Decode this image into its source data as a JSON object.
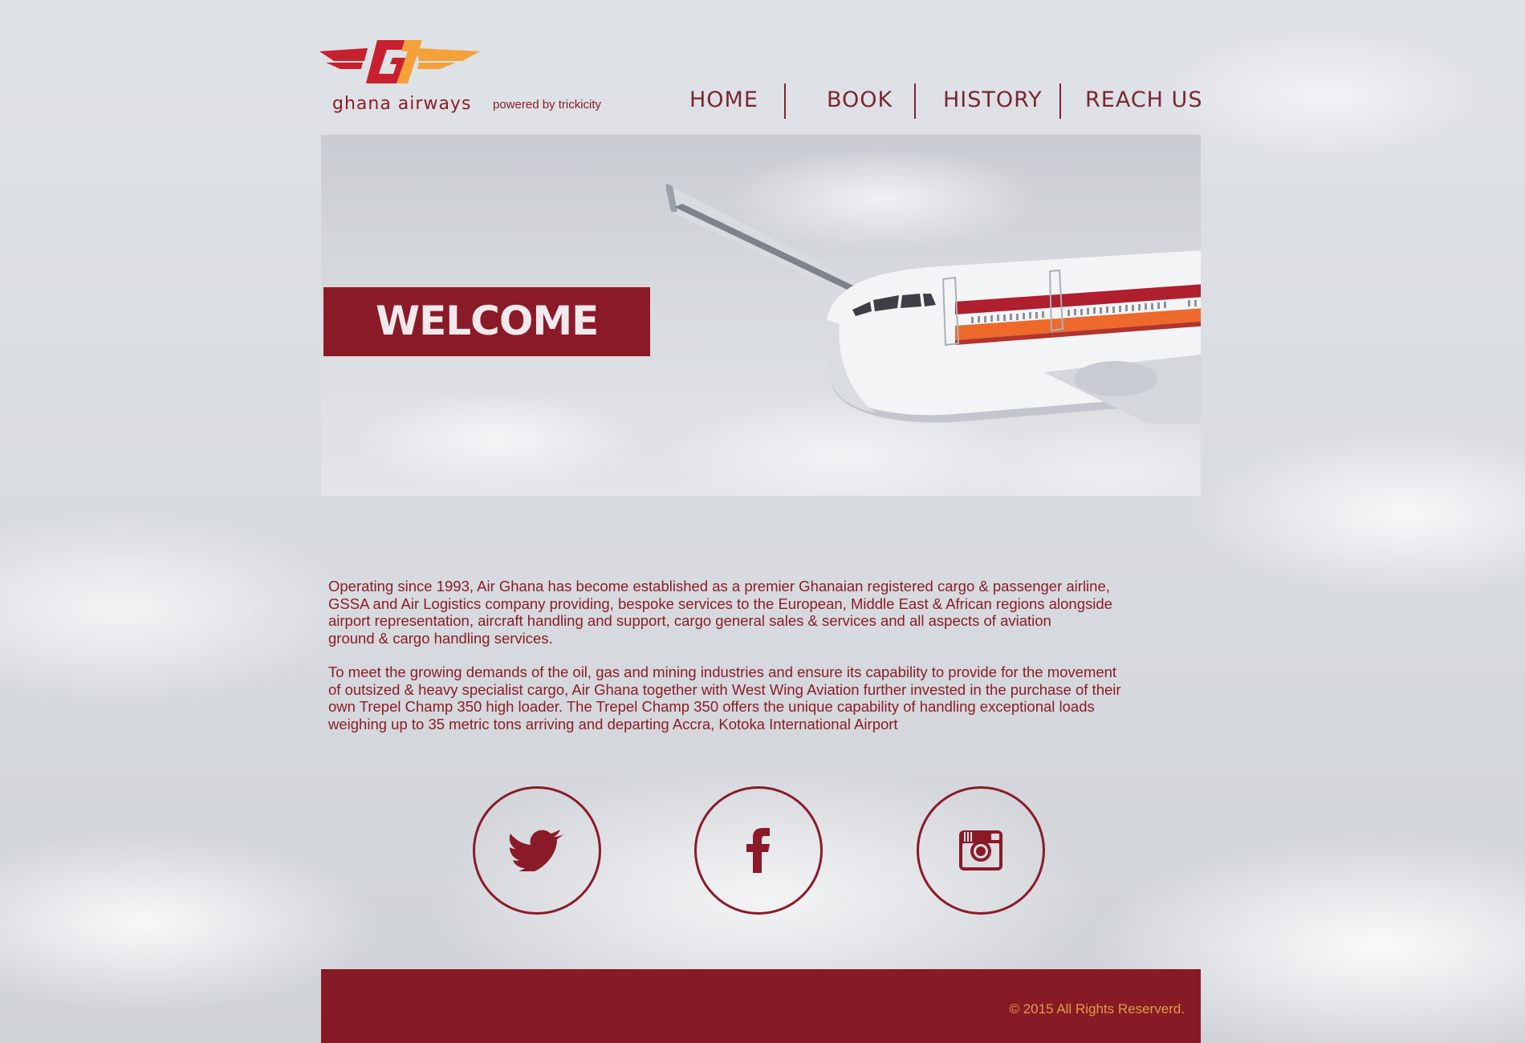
{
  "header": {
    "logo_text": "ghana airways",
    "powered_by": "powered by trickicity"
  },
  "nav": {
    "items": [
      {
        "label": "HOME"
      },
      {
        "label": "BOOK"
      },
      {
        "label": "HISTORY"
      },
      {
        "label": "REACH US"
      }
    ]
  },
  "hero": {
    "welcome": "WELCOME"
  },
  "content": {
    "paragraph_1": "Operating since 1993, Air Ghana has become established as a premier Ghanaian registered cargo & passenger airline,\nGSSA and Air Logistics company providing, bespoke services to the European, Middle East & African regions alongside\nairport representation, aircraft handling and support, cargo general sales & services and all aspects of aviation\nground & cargo handling services.",
    "paragraph_2": "To meet the growing demands of the oil, gas and mining industries and ensure its capability to provide for the movement\nof outsized & heavy specialist cargo, Air Ghana together with West Wing Aviation further invested in the purchase of their\n own Trepel Champ 350 high loader. The Trepel Champ 350 offers the unique capability of handling exceptional loads\nweighing up to 35 metric tons arriving and departing Accra, Kotoka International Airport"
  },
  "social": {
    "icons": [
      "twitter-icon",
      "facebook-icon",
      "instagram-icon"
    ]
  },
  "footer": {
    "copyright": "©  2015 All Rights Reserverd."
  },
  "colors": {
    "brand_red": "#8b1a28",
    "text_red": "#8a1d26",
    "footer_bg": "#861b26",
    "copyright_orange": "#e39a45",
    "logo_orange": "#f4a13a"
  }
}
